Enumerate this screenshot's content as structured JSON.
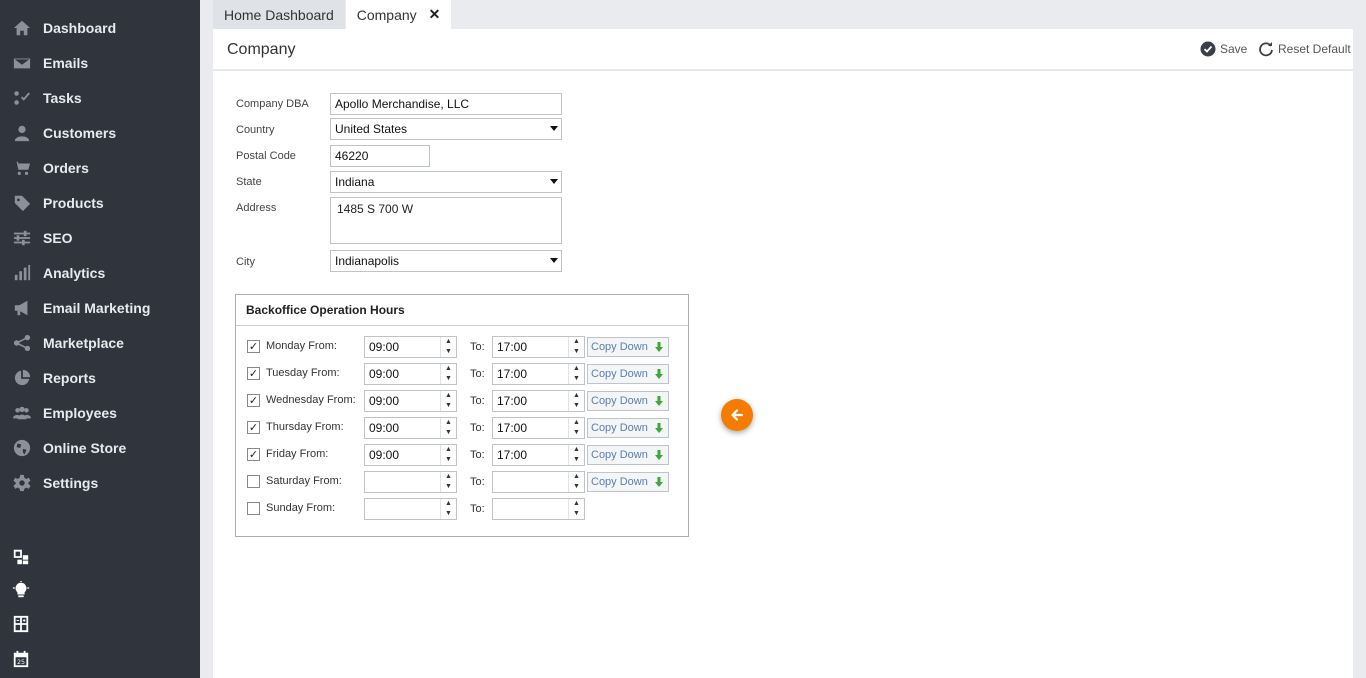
{
  "sidebar": {
    "items": [
      {
        "label": "Dashboard",
        "icon": "home-icon"
      },
      {
        "label": "Emails",
        "icon": "envelope-icon"
      },
      {
        "label": "Tasks",
        "icon": "tasks-icon"
      },
      {
        "label": "Customers",
        "icon": "user-icon"
      },
      {
        "label": "Orders",
        "icon": "cart-icon"
      },
      {
        "label": "Products",
        "icon": "tag-icon"
      },
      {
        "label": "SEO",
        "icon": "sliders-icon"
      },
      {
        "label": "Analytics",
        "icon": "bar-chart-icon"
      },
      {
        "label": "Email Marketing",
        "icon": "megaphone-icon"
      },
      {
        "label": "Marketplace",
        "icon": "share-icon"
      },
      {
        "label": "Reports",
        "icon": "pie-chart-icon"
      },
      {
        "label": "Employees",
        "icon": "users-icon"
      },
      {
        "label": "Online Store",
        "icon": "globe-icon"
      },
      {
        "label": "Settings",
        "icon": "gear-icon"
      }
    ],
    "bottom_icons": [
      "layout-icon",
      "lightbulb-icon",
      "calculator-icon",
      "calendar-icon"
    ],
    "calendar_day": "25"
  },
  "tabs": [
    {
      "label": "Home Dashboard",
      "active": false
    },
    {
      "label": "Company",
      "active": true,
      "close": "✕"
    }
  ],
  "header": {
    "title": "Company",
    "save_label": "Save",
    "reset_label": "Reset Default"
  },
  "form": {
    "dba_label": "Company DBA",
    "dba_value": "Apollo Merchandise, LLC",
    "country_label": "Country",
    "country_value": "United States",
    "postal_label": "Postal Code",
    "postal_value": "46220",
    "state_label": "State",
    "state_value": "Indiana",
    "address_label": "Address",
    "address_value": "1485 S 700 W",
    "city_label": "City",
    "city_value": "Indianapolis"
  },
  "hours": {
    "title": "Backoffice Operation Hours",
    "to_label": "To:",
    "copy_label": "Copy Down",
    "days": [
      {
        "label": "Monday From:",
        "checked": true,
        "from": "09:00",
        "to": "17:00",
        "copy": true
      },
      {
        "label": "Tuesday From:",
        "checked": true,
        "from": "09:00",
        "to": "17:00",
        "copy": true
      },
      {
        "label": "Wednesday From:",
        "checked": true,
        "from": "09:00",
        "to": "17:00",
        "copy": true
      },
      {
        "label": "Thursday From:",
        "checked": true,
        "from": "09:00",
        "to": "17:00",
        "copy": true
      },
      {
        "label": "Friday From:",
        "checked": true,
        "from": "09:00",
        "to": "17:00",
        "copy": true
      },
      {
        "label": "Saturday From:",
        "checked": false,
        "from": "",
        "to": "",
        "copy": true
      },
      {
        "label": "Sunday From:",
        "checked": false,
        "from": "",
        "to": "",
        "copy": false
      }
    ]
  },
  "colors": {
    "sidebar_bg": "#2f343d",
    "accent_orange": "#f57c00",
    "copy_arrow_green": "#3aa935"
  }
}
